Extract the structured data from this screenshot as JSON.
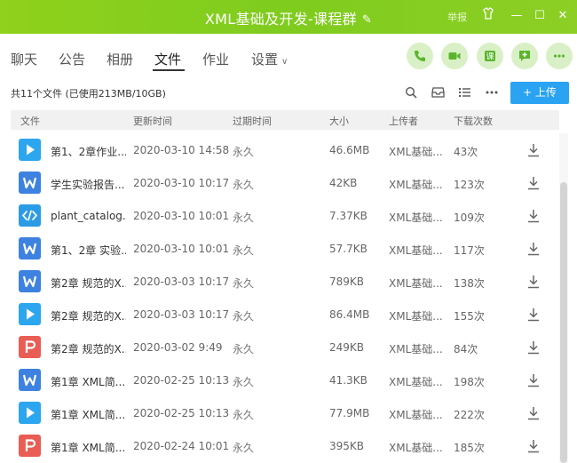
{
  "window": {
    "title": "XML基础及开发-课程群",
    "report_label": "举报"
  },
  "tabs": [
    {
      "label": "聊天"
    },
    {
      "label": "公告"
    },
    {
      "label": "相册"
    },
    {
      "label": "文件",
      "active": true
    },
    {
      "label": "作业"
    },
    {
      "label": "设置"
    }
  ],
  "actions": [
    "phone-icon",
    "video-icon",
    "lesson-icon",
    "message-icon",
    "more-icon"
  ],
  "toolbar": {
    "summary": "共11个文件 (已使用213MB/10GB)",
    "upload_label": "+ 上传"
  },
  "table": {
    "headers": {
      "name": "文件",
      "updated": "更新时间",
      "expire": "过期时间",
      "size": "大小",
      "uploader": "上传者",
      "downloads": "下载次数"
    },
    "rows": [
      {
        "type": "video",
        "name": "第1、2章作业...",
        "updated": "2020-03-10 14:58",
        "expire": "永久",
        "size": "46.6MB",
        "uploader": "XML基础...",
        "downloads": "43次"
      },
      {
        "type": "word",
        "name": "学生实验报告...",
        "updated": "2020-03-10 10:17",
        "expire": "永久",
        "size": "42KB",
        "uploader": "XML基础...",
        "downloads": "123次"
      },
      {
        "type": "code",
        "name": "plant_catalog...",
        "updated": "2020-03-10 10:01",
        "expire": "永久",
        "size": "7.37KB",
        "uploader": "XML基础...",
        "downloads": "109次"
      },
      {
        "type": "word",
        "name": "第1、2章 实验...",
        "updated": "2020-03-10 10:01",
        "expire": "永久",
        "size": "57.7KB",
        "uploader": "XML基础...",
        "downloads": "117次"
      },
      {
        "type": "word",
        "name": "第2章 规范的X...",
        "updated": "2020-03-03 10:17",
        "expire": "永久",
        "size": "789KB",
        "uploader": "XML基础...",
        "downloads": "138次"
      },
      {
        "type": "video",
        "name": "第2章 规范的X...",
        "updated": "2020-03-03 10:17",
        "expire": "永久",
        "size": "86.4MB",
        "uploader": "XML基础...",
        "downloads": "155次"
      },
      {
        "type": "ppt",
        "name": "第2章 规范的X...",
        "updated": "2020-03-02 9:49",
        "expire": "永久",
        "size": "249KB",
        "uploader": "XML基础...",
        "downloads": "84次"
      },
      {
        "type": "word",
        "name": "第1章 XML简...",
        "updated": "2020-02-25 10:13",
        "expire": "永久",
        "size": "41.3KB",
        "uploader": "XML基础...",
        "downloads": "198次"
      },
      {
        "type": "video",
        "name": "第1章 XML简...",
        "updated": "2020-02-25 10:13",
        "expire": "永久",
        "size": "77.9MB",
        "uploader": "XML基础...",
        "downloads": "222次"
      },
      {
        "type": "ppt",
        "name": "第1章 XML简...",
        "updated": "2020-02-24 10:01",
        "expire": "永久",
        "size": "395KB",
        "uploader": "XML基础...",
        "downloads": "185次"
      }
    ]
  },
  "colors": {
    "titlebar": "#86cf20",
    "accent": "#2aa3f2",
    "video": "#2ca6ee",
    "word": "#3d82e0",
    "code": "#2c9be6",
    "ppt": "#e95d55",
    "action_bg": "#d9f0c6",
    "action_fg": "#5bb52c"
  }
}
